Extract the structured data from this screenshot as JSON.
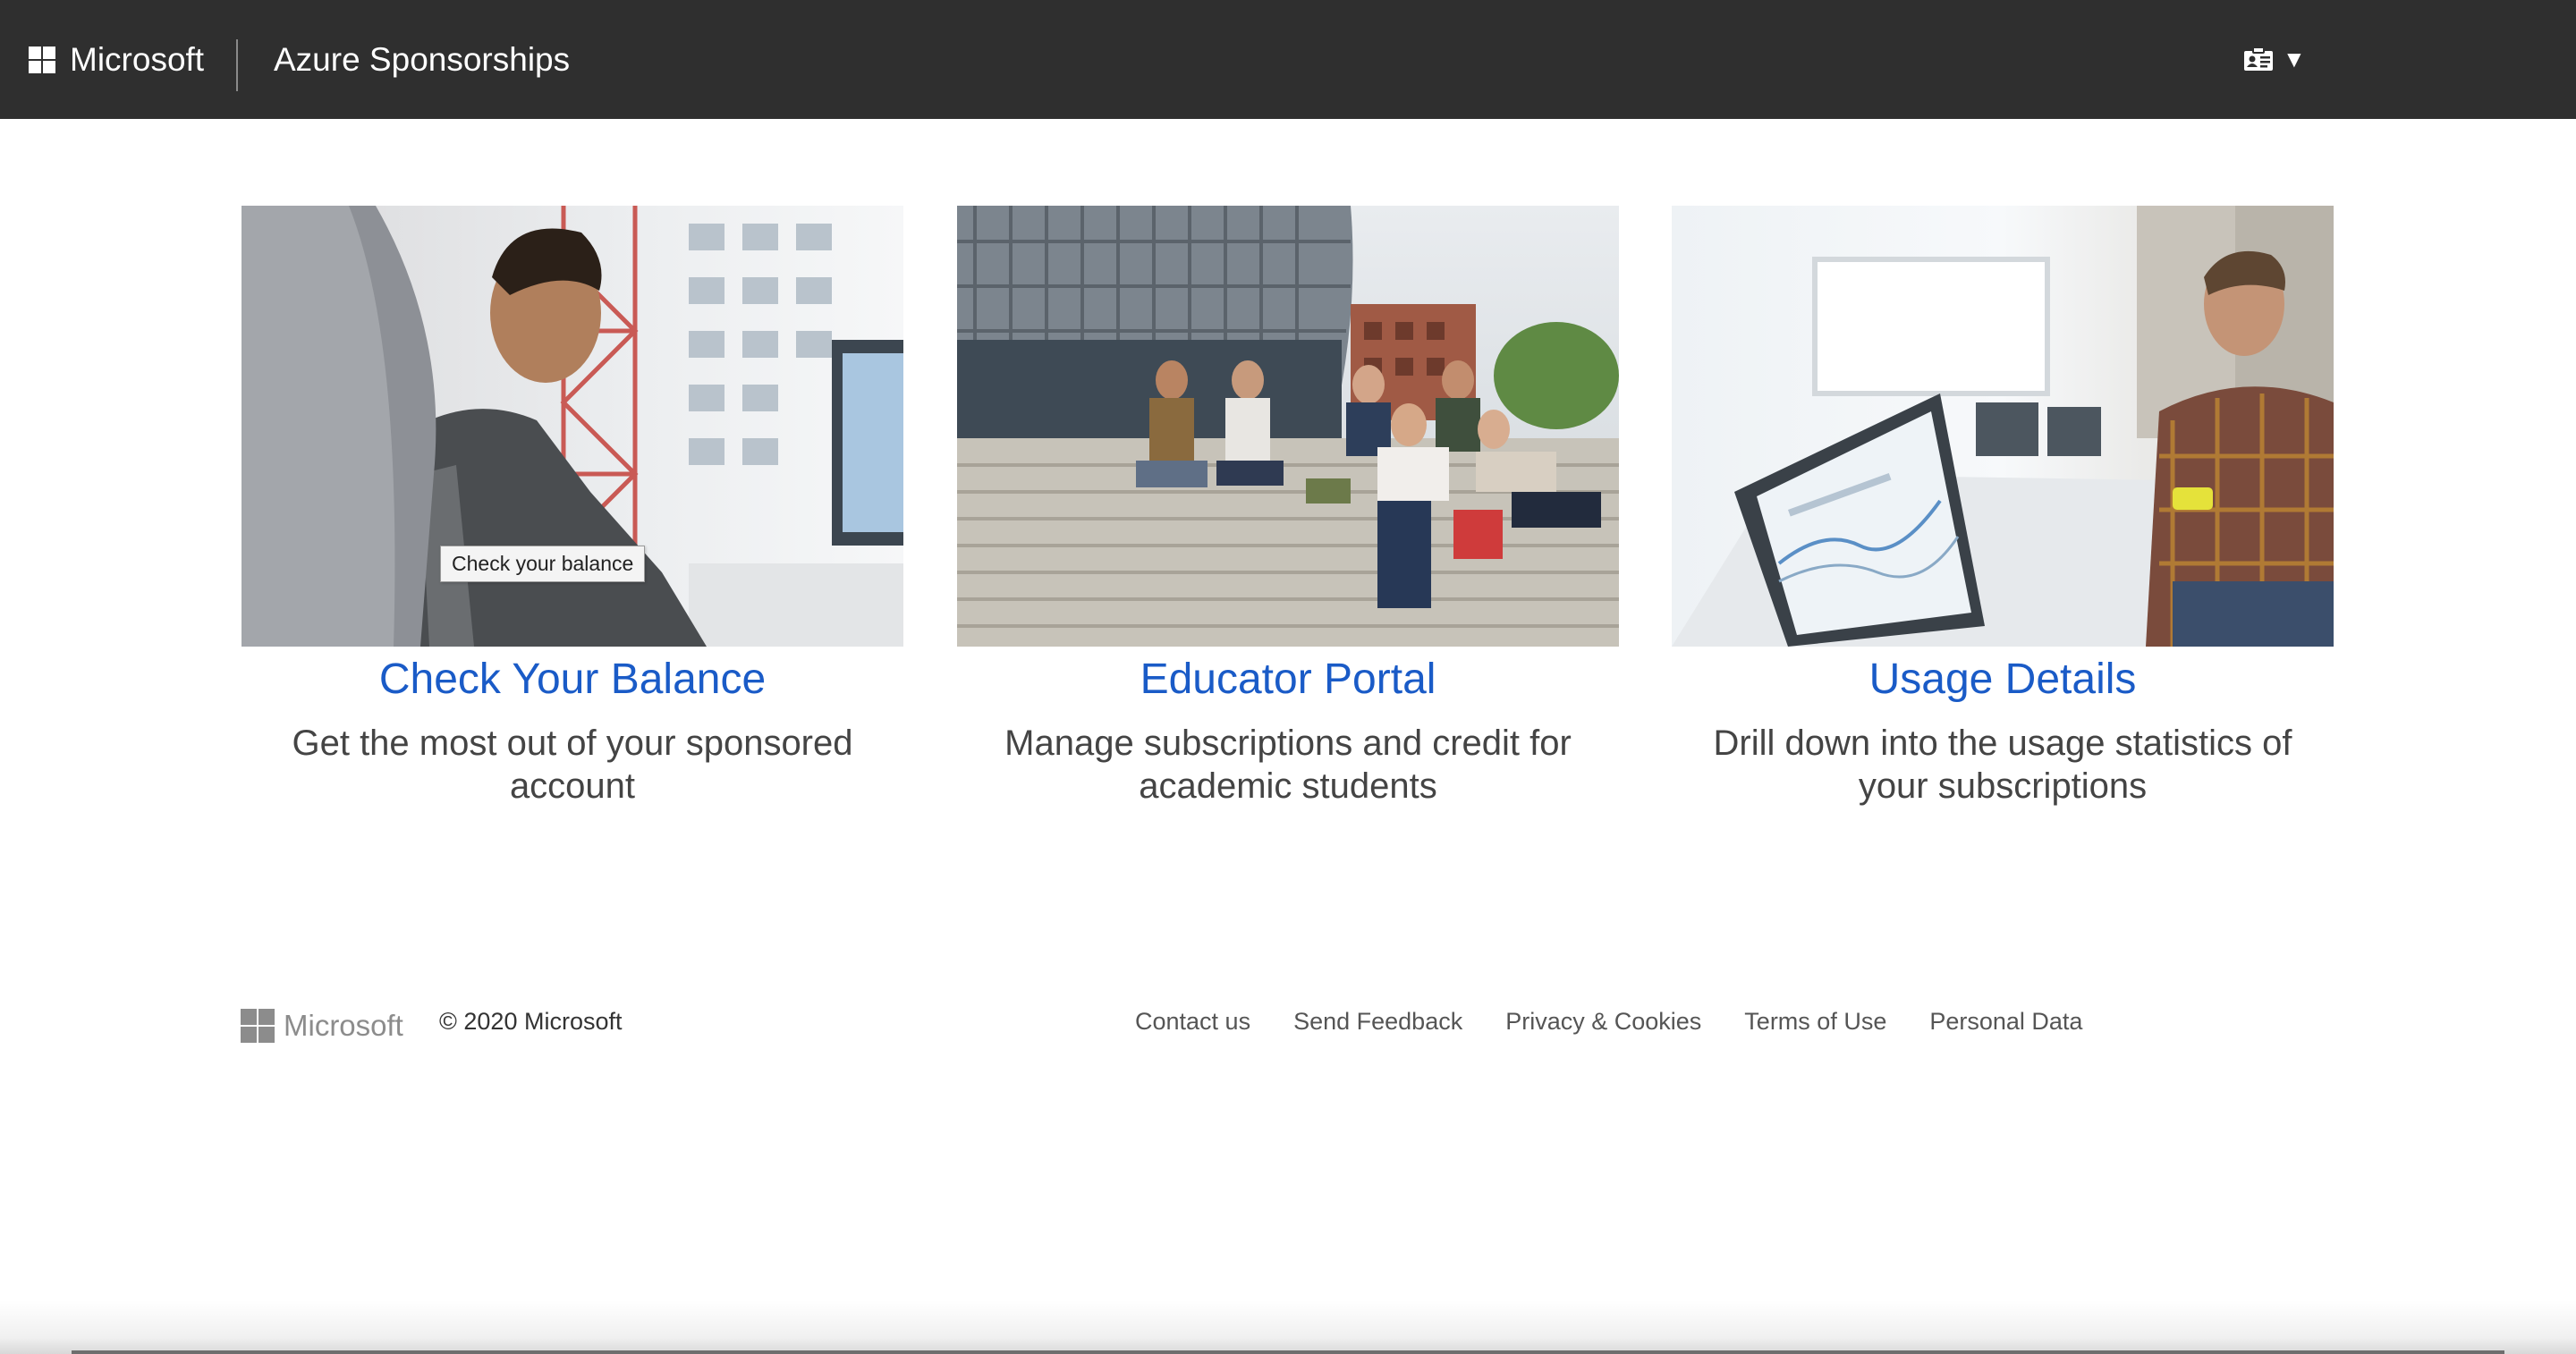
{
  "header": {
    "brand": "Microsoft",
    "site_title": "Azure Sponsorships",
    "account_icon": "id-card-icon",
    "menu_caret": "▼"
  },
  "cards": [
    {
      "title": "Check Your Balance",
      "description": "Get the most out of your sponsored account",
      "image": "office-man-at-monitor-photo"
    },
    {
      "title": "Educator Portal",
      "description": "Manage subscriptions and credit for academic students",
      "image": "students-on-steps-photo"
    },
    {
      "title": "Usage Details",
      "description": "Drill down into the usage statistics of your subscriptions",
      "image": "man-with-phone-at-dashboard-photo"
    }
  ],
  "tooltip": "Check your balance",
  "footer": {
    "brand": "Microsoft",
    "copyright": "© 2020 Microsoft",
    "links": [
      "Contact us",
      "Send Feedback",
      "Privacy & Cookies",
      "Terms of Use",
      "Personal Data"
    ]
  },
  "colors": {
    "header_bg": "#2f2f2f",
    "link_blue": "#1a5bc7",
    "body_text": "#444444"
  }
}
